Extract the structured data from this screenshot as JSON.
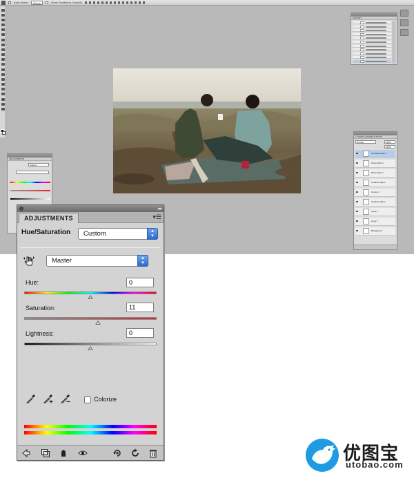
{
  "workspace": {
    "options_bar": {
      "items": [
        "Auto-Select",
        "Group",
        "Show Transform Controls"
      ]
    },
    "history_panel": {
      "tab": "HISTORY",
      "rows": 11,
      "selected_row": 10
    },
    "layers_panel": {
      "tabs": [
        "LAYERS",
        "CHANNELS",
        "PATHS"
      ],
      "blend_mode": "Normal",
      "opacity": "100%",
      "fill": "100%",
      "rows": [
        "Hue/Saturation 1",
        "Photo Filter 2",
        "Photo Filter 1",
        "Gradient Map 2",
        "Curves 1",
        "Gradient Map 1",
        "Layer 1",
        "Layer 1",
        "Background"
      ]
    },
    "mini_adjustments": {
      "tab": "ADJUSTMENTS",
      "preset": "Custom"
    }
  },
  "adjustments": {
    "tab_label": "ADJUSTMENTS",
    "header": "Hue/Saturation",
    "preset_value": "Custom",
    "channel_value": "Master",
    "hue": {
      "label": "Hue:",
      "value": "0",
      "position": 0.5
    },
    "saturation": {
      "label": "Saturation:",
      "value": "11",
      "position": 0.555
    },
    "lightness": {
      "label": "Lightness:",
      "value": "0",
      "position": 0.5
    },
    "colorize_label": "Colorize",
    "colorize_checked": false,
    "icons": {
      "on_image": "targeted-adjustment-hand-icon",
      "eyedroppers": [
        "eyedropper-icon",
        "eyedropper-plus-icon",
        "eyedropper-minus-icon"
      ],
      "footer": [
        "back-arrow-icon",
        "clip-to-layer-icon",
        "visibility-eye-toggle-icon",
        "eye-icon",
        "view-previous-state-icon",
        "reset-icon",
        "trash-icon"
      ]
    },
    "colors": {
      "accent": "#2d6ad0",
      "panel_bg": "#d3d3d3"
    }
  },
  "watermark": {
    "cn": "优图宝",
    "url": "utobao.com",
    "color": "#1e9be3"
  }
}
